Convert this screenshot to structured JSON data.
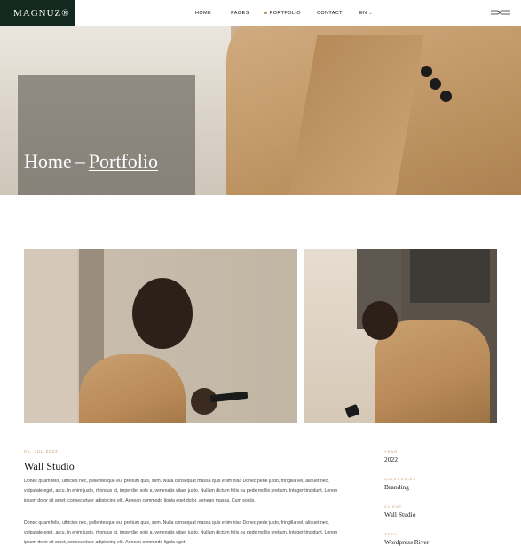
{
  "header": {
    "logo": "MAGNUZ®",
    "nav": [
      {
        "label": "HOME",
        "active": false,
        "chevron": false
      },
      {
        "label": "PAGES",
        "active": false,
        "chevron": false
      },
      {
        "label": "PORTFOLIO",
        "active": true,
        "chevron": false
      },
      {
        "label": "CONTACT",
        "active": false,
        "chevron": false
      },
      {
        "label": "EN",
        "active": false,
        "chevron": true
      }
    ],
    "menu_icon": "menu-icon"
  },
  "hero": {
    "home": "Home",
    "separator": "–",
    "current": "Portfolio"
  },
  "project": {
    "date": "04, JUL 2022",
    "title": "Wall Studio",
    "paragraph1": "Donec quam felis, ultricies nec, pellentesque eu, pretium quis, sem. Nulla consequat massa quis enim nisa Donec pede justo, fringilla vel, aliquet nec, vulputate eget, arcu. In enim justo, rhoncus ut, imperdiet sole a, venenatis vitae, justo. Nullam dictum felis eu pede mollis pretium. Integer tincidunt. Lorem ipsum dolor sit amet, consectetuer adipiscing elit. Aenean commodo ligula eget dolor, aenean massa. Cum sociis.",
    "paragraph2": "Donec quam felis, ultricies nec, pellentesque eu, pretium quis, sem. Nulla consequat massa quis enim nisa Donec pede justo, fringilla vel, aliquet nec, vulputate eget, arcu. In enim justo, rhoncus ut, imperdiet sole a, venenatis vitae, justo. Nullam dictum felis eu pede mollis pretium. Integer tincidunt. Lorem ipsum dolor sit amet, consectetuer adipiscing elit. Aenean commodo ligula eget"
  },
  "meta": {
    "year_label": "YEAR",
    "year": "2022",
    "category_label": "CATEGORIES",
    "category": "Branding",
    "client_label": "CLIENT",
    "client": "Wall Studio",
    "tech_label": "TECH",
    "tech": "Wordpress River"
  },
  "colors": {
    "logo_bg": "#13281f",
    "accent": "#c29a6a"
  }
}
